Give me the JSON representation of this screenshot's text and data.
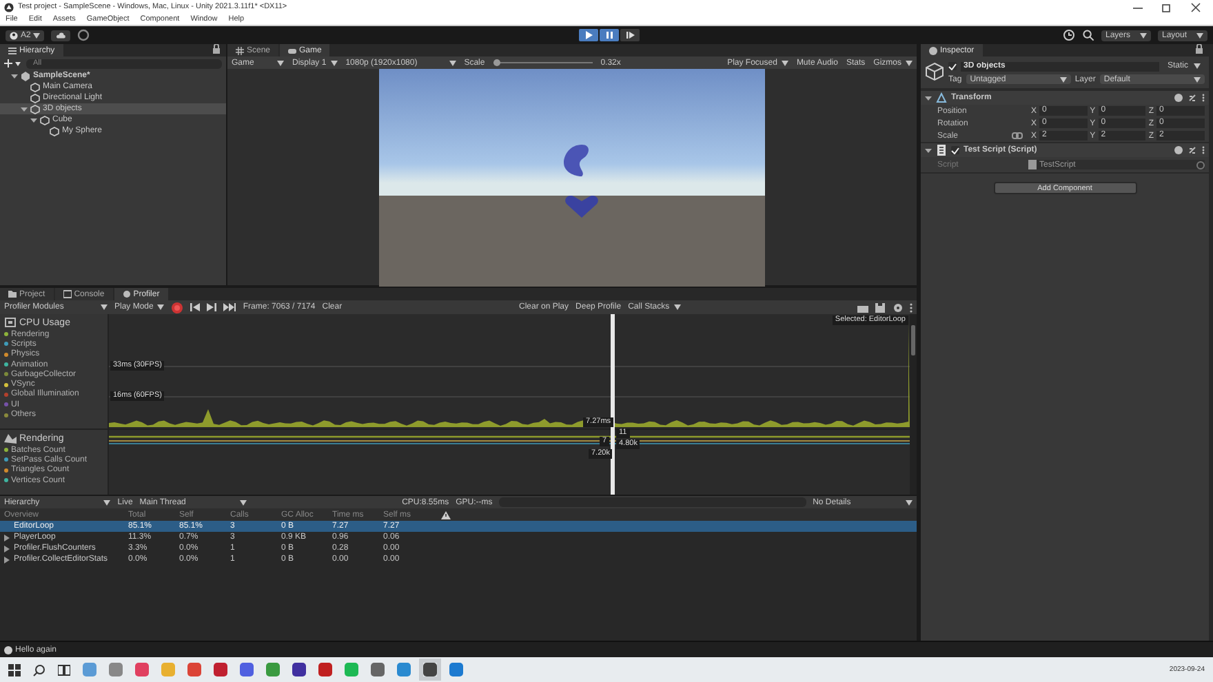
{
  "window": {
    "title": "Test project - SampleScene - Windows, Mac, Linux - Unity 2021.3.11f1* <DX11>"
  },
  "menu": [
    "File",
    "Edit",
    "Assets",
    "GameObject",
    "Component",
    "Window",
    "Help"
  ],
  "toolbar": {
    "account": "A2",
    "layers": "Layers",
    "layout": "Layout",
    "play": {
      "playing": true,
      "paused": true
    }
  },
  "hierarchy": {
    "tab": "Hierarchy",
    "search_placeholder": "All",
    "tree": [
      {
        "label": "SampleScene*",
        "kind": "scene",
        "selected": false,
        "expanded": true,
        "children": [
          {
            "label": "Main Camera",
            "kind": "object",
            "selected": false,
            "expanded": false
          },
          {
            "label": "Directional Light",
            "kind": "object",
            "selected": false,
            "expanded": false
          },
          {
            "label": "3D objects",
            "kind": "object",
            "selected": true,
            "expanded": true,
            "children": [
              {
                "label": "Cube",
                "kind": "object",
                "selected": false,
                "expanded": true,
                "children": [
                  {
                    "label": "My Sphere",
                    "kind": "object",
                    "selected": false,
                    "expanded": false
                  }
                ]
              }
            ]
          }
        ]
      }
    ]
  },
  "view": {
    "tabs": [
      {
        "label": "Scene",
        "selected": false
      },
      {
        "label": "Game",
        "selected": true
      }
    ],
    "toolbar": {
      "mode": "Game",
      "display": "Display 1",
      "resolution": "1080p (1920x1080)",
      "scale_label": "Scale",
      "scale_slider": {
        "level": 0
      },
      "scale": "0.32x",
      "play_focused": "Play Focused",
      "mute": "Mute Audio",
      "stats": "Stats",
      "gizmos": "Gizmos"
    }
  },
  "inspector": {
    "tab": "Inspector",
    "object": {
      "name": "3D objects",
      "active": true,
      "static": "Static",
      "tag_label": "Tag",
      "tag": "Untagged",
      "layer_label": "Layer",
      "layer": "Default"
    },
    "transform": {
      "title": "Transform",
      "rows": [
        {
          "label": "Position",
          "fields": [
            {
              "axis": "X",
              "value": "0"
            },
            {
              "axis": "Y",
              "value": "0"
            },
            {
              "axis": "Z",
              "value": "0"
            }
          ]
        },
        {
          "label": "Rotation",
          "fields": [
            {
              "axis": "X",
              "value": "0"
            },
            {
              "axis": "Y",
              "value": "0"
            },
            {
              "axis": "Z",
              "value": "0"
            }
          ]
        },
        {
          "label": "Scale",
          "fields": [
            {
              "axis": "X",
              "value": "2"
            },
            {
              "axis": "Y",
              "value": "2"
            },
            {
              "axis": "Z",
              "value": "2"
            }
          ]
        }
      ]
    },
    "script": {
      "title": "Test Script (Script)",
      "enabled": true,
      "field_label": "Script",
      "field_value": "TestScript"
    },
    "add_button": "Add Component"
  },
  "bottom_tabs": [
    {
      "label": "Project",
      "selected": false
    },
    {
      "label": "Console",
      "selected": false
    },
    {
      "label": "Profiler",
      "selected": true
    }
  ],
  "profiler": {
    "modules_label": "Profiler Modules",
    "mode": "Play Mode",
    "recording": true,
    "frame": "Frame: 7063 / 7174",
    "clear": "Clear",
    "clear_on_play": "Clear on Play",
    "deep_profile": "Deep Profile",
    "call_stacks": "Call Stacks",
    "modules": [
      {
        "title": "CPU Usage",
        "items": [
          {
            "name": "Rendering",
            "color": "#8db33b"
          },
          {
            "name": "Scripts",
            "color": "#3f9bb8"
          },
          {
            "name": "Physics",
            "color": "#d08a2c"
          },
          {
            "name": "Animation",
            "color": "#3fb4a0"
          },
          {
            "name": "GarbageCollector",
            "color": "#7c8a3a"
          },
          {
            "name": "VSync",
            "color": "#d4c03c"
          },
          {
            "name": "Global Illumination",
            "color": "#b3402c"
          },
          {
            "name": "UI",
            "color": "#7652a8"
          },
          {
            "name": "Others",
            "color": "#8a8a3c"
          }
        ]
      },
      {
        "title": "Rendering",
        "items": [
          {
            "name": "Batches Count",
            "color": "#8db33b"
          },
          {
            "name": "SetPass Calls Count",
            "color": "#3f9bb8"
          },
          {
            "name": "Triangles Count",
            "color": "#d08a2c"
          },
          {
            "name": "Vertices Count",
            "color": "#3fb4a0"
          }
        ]
      }
    ],
    "chart_labels": {
      "line_30": "33ms (30FPS)",
      "line_60": "16ms (60FPS)",
      "selected": "Selected: EditorLoop",
      "cpu_value": "7.27ms",
      "batches": "11",
      "setpass": "7",
      "triangles": "4.80k",
      "vertices": "7.20k"
    },
    "details": {
      "view": "Hierarchy",
      "live": "Live",
      "thread": "Main Thread",
      "cpu": "CPU:8.55ms",
      "gpu": "GPU:--ms",
      "details_mode": "No Details",
      "columns": [
        "Overview",
        "Total",
        "Self",
        "Calls",
        "GC Alloc",
        "Time ms",
        "Self ms"
      ],
      "rows": [
        {
          "cells": [
            "EditorLoop",
            "85.1%",
            "85.1%",
            "3",
            "0 B",
            "7.27",
            "7.27"
          ],
          "selected": true,
          "expandable": false
        },
        {
          "cells": [
            "PlayerLoop",
            "11.3%",
            "0.7%",
            "3",
            "0.9 KB",
            "0.96",
            "0.06"
          ],
          "selected": false,
          "expandable": true
        },
        {
          "cells": [
            "Profiler.FlushCounters",
            "3.3%",
            "0.0%",
            "1",
            "0 B",
            "0.28",
            "0.00"
          ],
          "selected": false,
          "expandable": true
        },
        {
          "cells": [
            "Profiler.CollectEditorStats",
            "0.0%",
            "0.0%",
            "1",
            "0 B",
            "0.00",
            "0.00"
          ],
          "selected": false,
          "expandable": true
        }
      ]
    }
  },
  "status_bar": "Hello again",
  "taskbar": {
    "clock": "2023-09-24"
  }
}
